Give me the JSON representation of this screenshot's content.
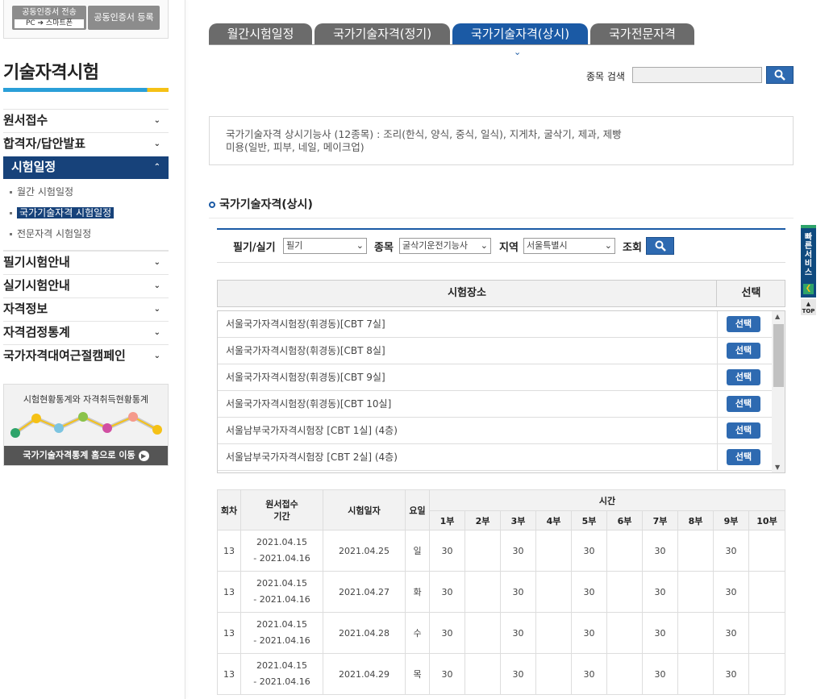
{
  "cert": {
    "transfer_label": "공동인증서 전송",
    "transfer_sub": "PC ➔ 스마트폰",
    "register_label": "공동인증서 등록"
  },
  "sidebar": {
    "title": "기술자격시험",
    "items": [
      {
        "label": "원서접수"
      },
      {
        "label": "합격자/답안발표"
      },
      {
        "label": "시험일정"
      },
      {
        "label": "필기시험안내"
      },
      {
        "label": "실기시험안내"
      },
      {
        "label": "자격정보"
      },
      {
        "label": "자격검정통계"
      },
      {
        "label": "국가자격대여근절캠페인"
      }
    ],
    "sub_items": [
      {
        "label": "월간 시험일정"
      },
      {
        "label": "국가기술자격 시험일정"
      },
      {
        "label": "전문자격 시험일정"
      }
    ],
    "stats_title": "시험현황통계와 자격취득현황통계",
    "stats_link": "국가기술자격통계 홈으로 이동"
  },
  "tabs": [
    {
      "label": "월간시험일정"
    },
    {
      "label": "국가기술자격(정기)"
    },
    {
      "label": "국가기술자격(상시)"
    },
    {
      "label": "국가전문자격"
    }
  ],
  "search": {
    "label": "종목 검색",
    "value": ""
  },
  "info": {
    "line1": "국가기술자격 상시기능사 (12종목) : 조리(한식, 양식, 중식, 일식), 지게차, 굴삭기, 제과, 제빵",
    "line2": "미용(일반, 피부, 네일, 메이크업)"
  },
  "section_title": "국가기술자격(상시)",
  "filters": {
    "type_label": "필기/실기",
    "type_value": "필기",
    "item_label": "종목",
    "item_value": "굴삭기운전기능사",
    "region_label": "지역",
    "region_value": "서울특별시",
    "lookup_label": "조회"
  },
  "venues": {
    "header_place": "시험장소",
    "header_select": "선택",
    "select_label": "선택",
    "rows": [
      {
        "name": "서울국가자격시험장(휘경동)[CBT 7실]"
      },
      {
        "name": "서울국가자격시험장(휘경동)[CBT 8실]"
      },
      {
        "name": "서울국가자격시험장(휘경동)[CBT 9실]"
      },
      {
        "name": "서울국가자격시험장(휘경동)[CBT 10실]"
      },
      {
        "name": "서울남부국가자격시험장 [CBT 1실] (4층)"
      },
      {
        "name": "서울남부국가자격시험장 [CBT 2실] (4층)"
      }
    ]
  },
  "schedule": {
    "headers": {
      "round": "회차",
      "apply_line1": "원서접수",
      "apply_line2": "기간",
      "exam_date": "시험일자",
      "weekday": "요일",
      "time": "시간",
      "sessions": [
        "1부",
        "2부",
        "3부",
        "4부",
        "5부",
        "6부",
        "7부",
        "8부",
        "9부",
        "10부"
      ]
    },
    "rows": [
      {
        "round": "13",
        "apply_start": "2021.04.15",
        "apply_end": "- 2021.04.16",
        "date": "2021.04.25",
        "weekday": "일",
        "sessions": [
          "30",
          "",
          "30",
          "",
          "30",
          "",
          "30",
          "",
          "30",
          ""
        ]
      },
      {
        "round": "13",
        "apply_start": "2021.04.15",
        "apply_end": "- 2021.04.16",
        "date": "2021.04.27",
        "weekday": "화",
        "sessions": [
          "30",
          "",
          "30",
          "",
          "30",
          "",
          "30",
          "",
          "30",
          ""
        ]
      },
      {
        "round": "13",
        "apply_start": "2021.04.15",
        "apply_end": "- 2021.04.16",
        "date": "2021.04.28",
        "weekday": "수",
        "sessions": [
          "30",
          "",
          "30",
          "",
          "30",
          "",
          "30",
          "",
          "30",
          ""
        ]
      },
      {
        "round": "13",
        "apply_start": "2021.04.15",
        "apply_end": "- 2021.04.16",
        "date": "2021.04.29",
        "weekday": "목",
        "sessions": [
          "30",
          "",
          "30",
          "",
          "30",
          "",
          "30",
          "",
          "30",
          ""
        ]
      }
    ]
  },
  "quick": {
    "label": "빠른서비스",
    "top_label": "TOP"
  },
  "icons": {
    "search": "search-icon",
    "chevron": "chevron-down-icon"
  },
  "colors": {
    "primary": "#1b5aa5",
    "nav_active": "#17427a",
    "tab_inactive": "#6b6b6b"
  }
}
